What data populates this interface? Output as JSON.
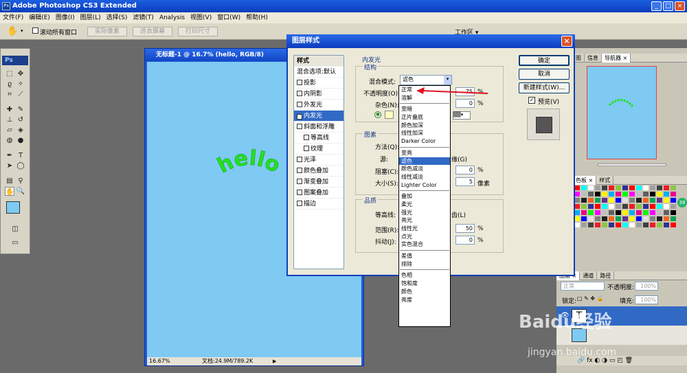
{
  "app": {
    "title": "Adobe Photoshop CS3 Extended",
    "icon_label": "Ps"
  },
  "menu": [
    "文件(F)",
    "编辑(E)",
    "图像(I)",
    "图层(L)",
    "选择(S)",
    "滤镜(T)",
    "Analysis",
    "视图(V)",
    "窗口(W)",
    "帮助(H)"
  ],
  "options": {
    "scroll_all": "滚动所有窗口",
    "actual_pixels": "实际像素",
    "fit_screen": "适合屏幕",
    "print_size": "打印尺寸",
    "workspace": "工作区 ▾"
  },
  "toolbox": {
    "ps_label": "Ps"
  },
  "document": {
    "title": "无标题-1 @ 16.7% (hello, RGB/8)",
    "canvas_text": "hello",
    "canvas_color": "#7ecaf2",
    "text_color": "#22e022",
    "zoom": "16.67%",
    "doc_size": "文档:24.9M/789.2K"
  },
  "dialog": {
    "title": "图层样式",
    "close": "×",
    "styles_header": "样式",
    "blend_options": "混合选项:默认",
    "style_items": [
      {
        "label": "投影",
        "checked": false,
        "indent": false
      },
      {
        "label": "内阴影",
        "checked": false,
        "indent": false
      },
      {
        "label": "外发光",
        "checked": false,
        "indent": false
      },
      {
        "label": "内发光",
        "checked": true,
        "indent": false,
        "selected": true
      },
      {
        "label": "斜面和浮雕",
        "checked": false,
        "indent": false
      },
      {
        "label": "等高线",
        "checked": false,
        "indent": true
      },
      {
        "label": "纹理",
        "checked": false,
        "indent": true
      },
      {
        "label": "光泽",
        "checked": false,
        "indent": false
      },
      {
        "label": "颜色叠加",
        "checked": false,
        "indent": false
      },
      {
        "label": "渐变叠加",
        "checked": false,
        "indent": false
      },
      {
        "label": "图案叠加",
        "checked": false,
        "indent": false
      },
      {
        "label": "描边",
        "checked": false,
        "indent": false
      }
    ],
    "section_title": "内发光",
    "structure_title": "结构",
    "blend_mode_label": "混合模式:",
    "blend_mode_value": "滤色",
    "opacity_label": "不透明度(O):",
    "opacity_value": "75",
    "noise_label": "杂色(N):",
    "noise_value": "0",
    "percent": "%",
    "elements_title": "图素",
    "method_label": "方法(Q):",
    "source_label": "源:",
    "source_tail": "缘(G)",
    "choke_label": "阻塞(C):",
    "choke_value": "0",
    "size_label": "大小(S):",
    "size_value": "5",
    "pixels": "像素",
    "quality_title": "品质",
    "contour_label": "等高线:",
    "contour_tail": "齿(L)",
    "range_label": "范围(R):",
    "range_value": "50",
    "jitter_label": "抖动(J):",
    "jitter_value": "0",
    "ok": "确定",
    "cancel": "取消",
    "new_style": "新建样式(W)...",
    "preview": "预览(V)"
  },
  "blend_modes": {
    "group1": [
      "正常",
      "溶解"
    ],
    "group2": [
      "变暗",
      "正片叠底",
      "颜色加深",
      "线性加深",
      "Darker Color"
    ],
    "group3": [
      "变亮",
      "滤色",
      "颜色减淡",
      "线性减淡",
      "Lighter Color"
    ],
    "group4": [
      "叠加",
      "柔光",
      "强光",
      "亮光",
      "线性光",
      "点光",
      "实色混合"
    ],
    "group5": [
      "差值",
      "排除"
    ],
    "group6": [
      "色相",
      "饱和度",
      "颜色",
      "亮度"
    ],
    "selected": "滤色"
  },
  "right_panel": {
    "tabs1": [
      "图",
      "信息",
      "导航器 ×"
    ],
    "tabs2": [
      "色板 ×",
      "样式"
    ],
    "tabs3": [
      "图层 ×",
      "通道",
      "路径"
    ],
    "layer_mode": "正常",
    "opacity_label": "不透明度:",
    "opacity_value": "100%",
    "lock_label": "锁定:",
    "fill_label": "填充:",
    "fill_value": "100%",
    "badge": "38"
  },
  "watermark": {
    "brand": "Baidu经验",
    "url": "jingyan.baidu.com"
  }
}
